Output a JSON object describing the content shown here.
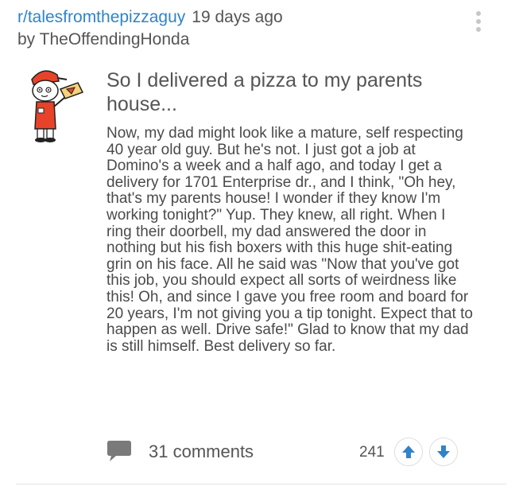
{
  "post": {
    "subreddit": "r/talesfromthepizzaguy",
    "time_ago": "19 days ago",
    "byline": "by TheOffendingHonda",
    "title": "So I delivered a pizza to my parents house...",
    "body": "Now, my dad might look like a mature, self respecting 40 year old guy. But he's not. I just got a job at Domino's a week and a half ago, and today I get a delivery for 1701 Enterprise dr., and I think, \"Oh hey, that's my parents house! I wonder if they know I'm working tonight?\" Yup. They knew, all right. When I ring their doorbell, my dad answered the door in nothing but his fish boxers with this huge shit-eating grin on his face. All he said was \"Now that you've got this job, you should expect all sorts of weirdness like this! Oh, and since I gave you free room and board for 20 years, I'm not giving you a tip tonight. Expect that to happen as well. Drive safe!\" Glad to know that my dad is still himself. Best delivery so far.",
    "comments_label": "31 comments",
    "score": "241"
  },
  "icons": {
    "thumbnail": "pizza-delivery-mascot-icon",
    "comments": "speech-bubble-icon",
    "upvote": "arrow-up-icon",
    "downvote": "arrow-down-icon",
    "menu": "vertical-dots-icon"
  },
  "colors": {
    "link": "#2f84c9",
    "text": "#555555",
    "vote_arrow": "#2f84c9",
    "mascot_red": "#e8432a",
    "divider": "#e4e4e4"
  }
}
